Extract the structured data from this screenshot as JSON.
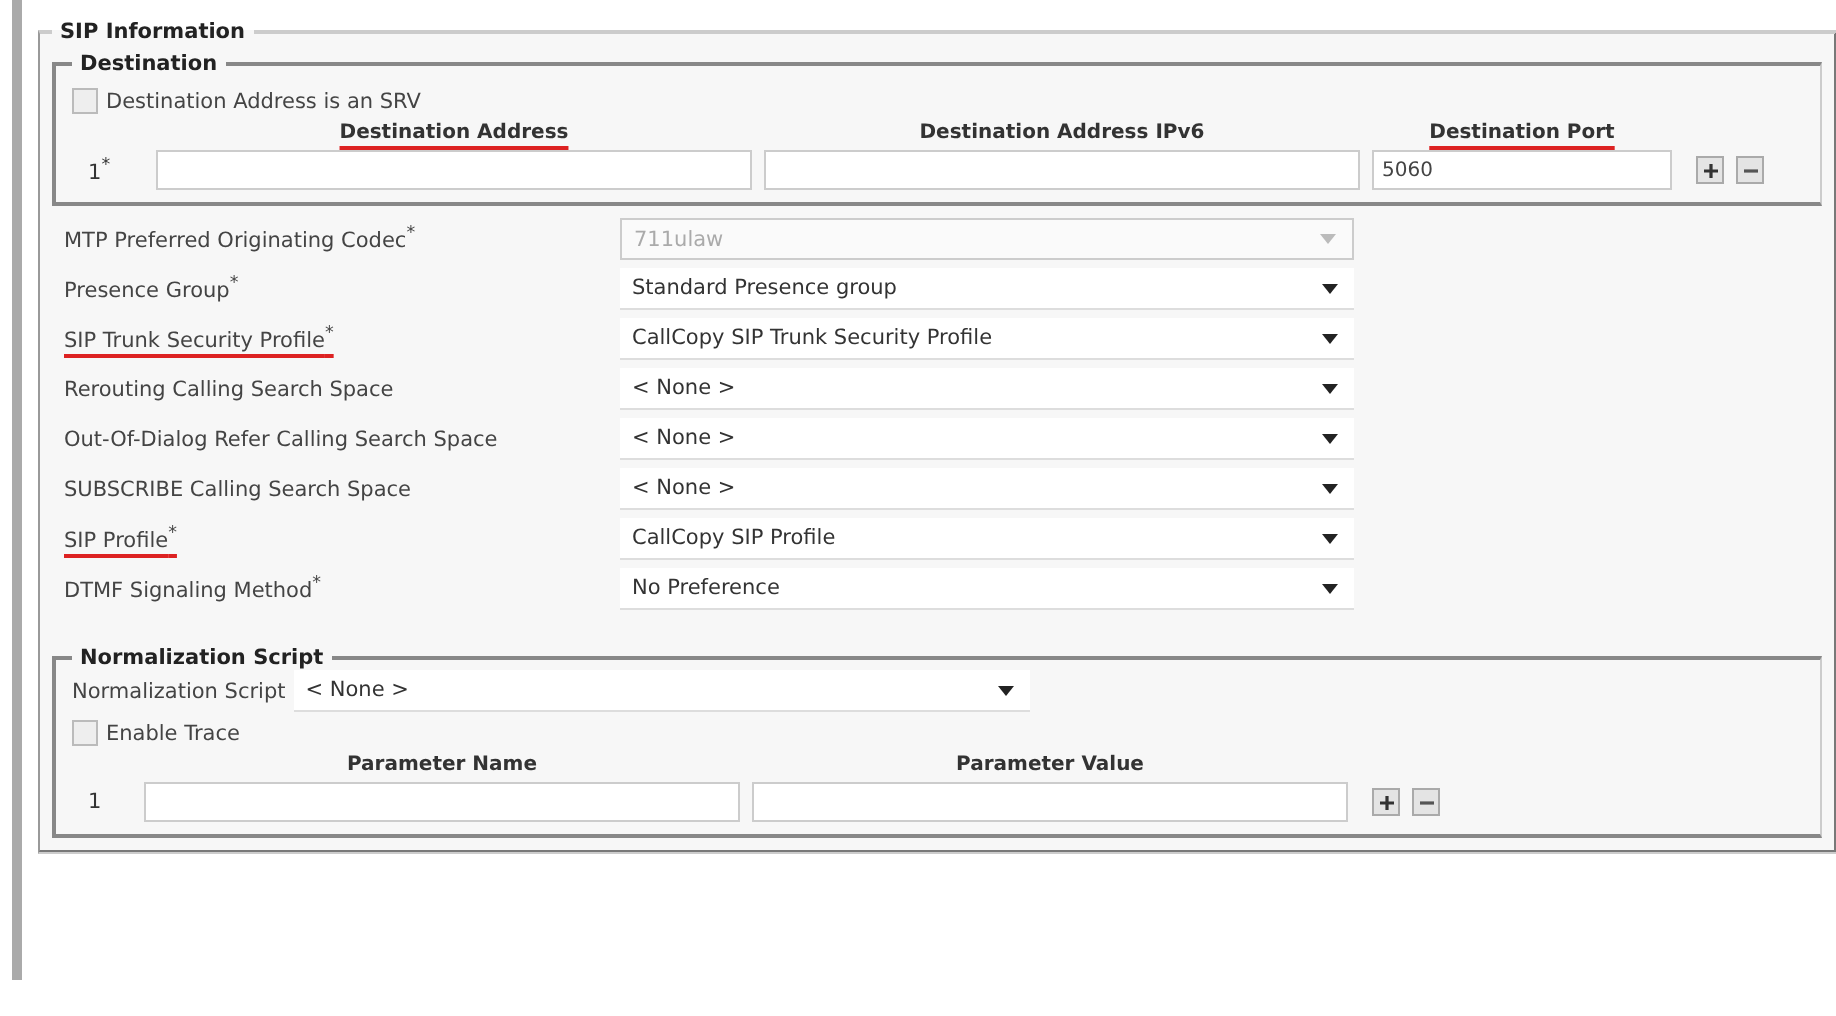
{
  "section": {
    "title": "SIP Information"
  },
  "destination": {
    "title": "Destination",
    "srv": {
      "label": "Destination Address is an SRV",
      "checked": false
    },
    "columns": [
      {
        "label": "Destination Address",
        "underlined": true
      },
      {
        "label": "Destination Address IPv6",
        "underlined": false
      },
      {
        "label": "Destination Port",
        "underlined": true
      }
    ],
    "rows": [
      {
        "index": "1$^{*}$",
        "port": "5060"
      }
    ]
  },
  "fields": [
    {
      "label": "MTP Preferred Originating Codec$^{*}$",
      "underlined": false,
      "value": "711ulaw",
      "disabled": true
    },
    {
      "label": "Presence Group$^{*}$",
      "underlined": false,
      "value": "Standard Presence group",
      "disabled": false
    },
    {
      "label": "SIP Trunk Security Profile$^{*}$",
      "underlined": true,
      "value": "CallCopy SIP Trunk Security Profile",
      "disabled": false
    },
    {
      "label": "Rerouting Calling Search Space",
      "underlined": false,
      "value": "< None >",
      "disabled": false
    },
    {
      "label": "Out-Of-Dialog Refer Calling Search Space",
      "underlined": false,
      "value": "< None >",
      "disabled": false
    },
    {
      "label": "SUBSCRIBE Calling Search Space",
      "underlined": false,
      "value": "< None >",
      "disabled": false
    },
    {
      "label": "SIP Profile$^{*}$",
      "underlined": true,
      "value": "CallCopy SIP Profile",
      "disabled": false
    },
    {
      "label": "DTMF Signaling Method$^{*}$",
      "underlined": false,
      "value": "No Preference",
      "disabled": false
    }
  ],
  "normalization": {
    "title": "Normalization Script",
    "script": {
      "label": "Normalization Script",
      "value": "< None >"
    },
    "trace": {
      "label": "Enable Trace",
      "checked": false
    },
    "columns": [
      "Parameter Name",
      "Parameter Value"
    ],
    "rows": [
      {
        "index": "1"
      }
    ]
  }
}
